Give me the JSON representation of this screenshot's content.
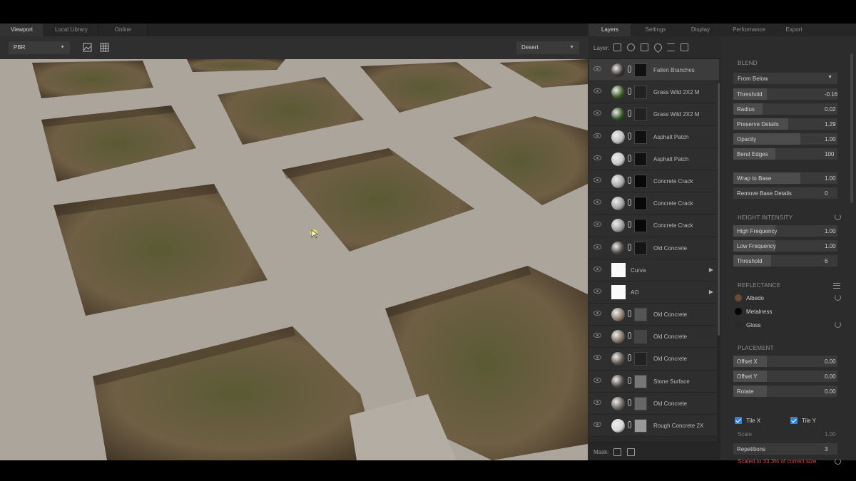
{
  "tabs_left": [
    {
      "label": "Viewport",
      "active": true
    },
    {
      "label": "Local Library",
      "active": false
    },
    {
      "label": "Online",
      "active": false
    }
  ],
  "tabs_right": [
    {
      "label": "Layers",
      "active": true
    },
    {
      "label": "Settings",
      "active": false
    },
    {
      "label": "Display",
      "active": false
    },
    {
      "label": "Performance",
      "active": false
    },
    {
      "label": "Export",
      "active": false
    }
  ],
  "viewport": {
    "render_mode": "PBR",
    "environment": "Desert"
  },
  "layers_panel": {
    "toolbar_label": "Layer:",
    "mask_label": "Mask:",
    "layers": [
      {
        "name": "Fallen Branches",
        "ball": "#3a3632",
        "mask": "#111",
        "selected": true
      },
      {
        "name": "Grass Wild 2X2 M",
        "ball": "#3d5a25",
        "mask": "#222"
      },
      {
        "name": "Grass Wild 2X2 M",
        "ball": "#2f5020",
        "mask": "#222"
      },
      {
        "name": "Asphalt Patch",
        "ball": "#bdbdbd",
        "mask": "#111"
      },
      {
        "name": "Asphalt Patch",
        "ball": "#c8c8c8",
        "mask": "#111"
      },
      {
        "name": "Concrete Crack",
        "ball": "#a7a7a7",
        "mask": "#080808"
      },
      {
        "name": "Concrete Crack",
        "ball": "#a0a0a0",
        "mask": "#080808"
      },
      {
        "name": "Concrete Crack",
        "ball": "#9c9c9c",
        "mask": "#080808"
      },
      {
        "name": "Old Concrete",
        "ball": "#4a4440",
        "mask": "#151515"
      },
      {
        "name": "Curva",
        "type": "folder"
      },
      {
        "name": "AO",
        "type": "folder"
      },
      {
        "name": "Old Concrete",
        "ball": "#8a7a68",
        "mask": "#555"
      },
      {
        "name": "Old Concrete",
        "ball": "#7d7164",
        "mask": "#444"
      },
      {
        "name": "Old Concrete",
        "ball": "#5c544c",
        "mask": "#222"
      },
      {
        "name": "Stone Surface",
        "ball": "#4e4740",
        "mask": "#777"
      },
      {
        "name": "Old Concrete",
        "ball": "#6a645e",
        "mask": "#666"
      },
      {
        "name": "Rough Concrete 2X",
        "ball": "#d8d8d8",
        "mask": "#999"
      }
    ]
  },
  "props": {
    "blend": {
      "title": "BLEND",
      "mode": "From Below",
      "fields": [
        {
          "label": "Threshold",
          "value": "-0.16",
          "fill": 0.4
        },
        {
          "label": "Radius",
          "value": "0.02",
          "fill": 0.35
        },
        {
          "label": "Preserve Details",
          "value": "1.29",
          "fill": 0.65
        },
        {
          "label": "Opacity",
          "value": "1.00",
          "fill": 0.8
        },
        {
          "label": "Bend Edges",
          "value": "100",
          "fill": 0.5
        },
        {
          "label": "Wrap to Base",
          "value": "1.00",
          "fill": 0.8
        },
        {
          "label": "Remove Base Details",
          "value": "0",
          "fill": 0.0
        }
      ]
    },
    "height": {
      "title": "HEIGHT INTENSITY",
      "fields": [
        {
          "label": "High Frequency",
          "value": "1.00",
          "fill": 0.5
        },
        {
          "label": "Low Frequency",
          "value": "1.00",
          "fill": 0.5
        },
        {
          "label": "Threshold",
          "value": "6",
          "fill": 0.45
        }
      ]
    },
    "reflectance": {
      "title": "REFLECTANCE",
      "items": [
        {
          "label": "Albedo",
          "color": "#6b4b36"
        },
        {
          "label": "Metalness",
          "color": "#050505"
        },
        {
          "label": "Gloss",
          "color": "#2a2a2a"
        }
      ]
    },
    "placement": {
      "title": "PLACEMENT",
      "fields": [
        {
          "label": "Offset X",
          "value": "0.00",
          "fill": 0.4
        },
        {
          "label": "Offset Y",
          "value": "0.00",
          "fill": 0.4
        },
        {
          "label": "Rotate",
          "value": "0.00",
          "fill": 0.4
        }
      ],
      "tile_x": "Tile X",
      "tile_y": "Tile Y",
      "scale_label": "Scale",
      "scale_value": "1.00",
      "repetitions_label": "Repetitions",
      "repetitions_value": "3",
      "note": "Scaled to 33.3% of correct size."
    }
  },
  "colors": {
    "accent": "#2f86d6",
    "warning": "#c94f4f"
  }
}
